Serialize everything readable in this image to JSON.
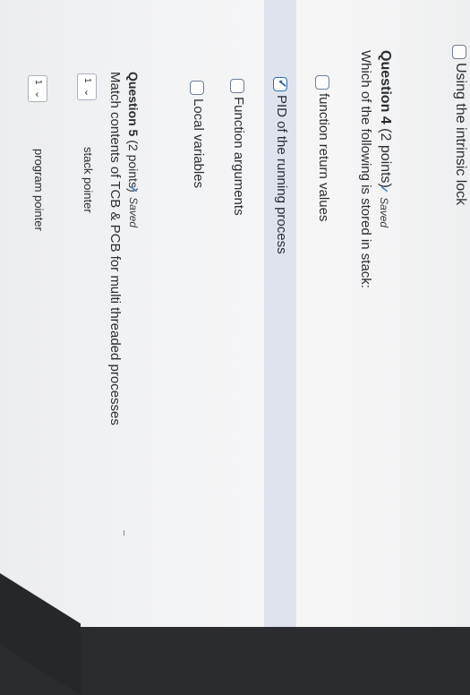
{
  "prev_question": {
    "option_label": "Using the intrinsic lock"
  },
  "question4": {
    "number": "Question 4",
    "points": "(2 points)",
    "saved_label": "Saved",
    "prompt": "Which of the following is stored in stack:",
    "options": [
      {
        "label": "function return values",
        "selected": false
      },
      {
        "label": "PID of the running process",
        "selected": true
      },
      {
        "label": "Function arguments",
        "selected": false
      },
      {
        "label": "Local variables",
        "selected": false
      }
    ]
  },
  "question5": {
    "number": "Question 5",
    "points": "(2 points)",
    "saved_label": "Saved",
    "prompt": "Match contents of TCB & PCB for multi threaded processes",
    "rows": [
      {
        "select_value": "1",
        "label": "stack pointer"
      },
      {
        "select_value": "1",
        "label": "program pointer"
      }
    ]
  },
  "colors": {
    "check": "#4a7dbf",
    "highlight": "#dfe3ee"
  },
  "icons": {
    "check": "check-icon",
    "dropdown": "chevron-down-icon"
  }
}
